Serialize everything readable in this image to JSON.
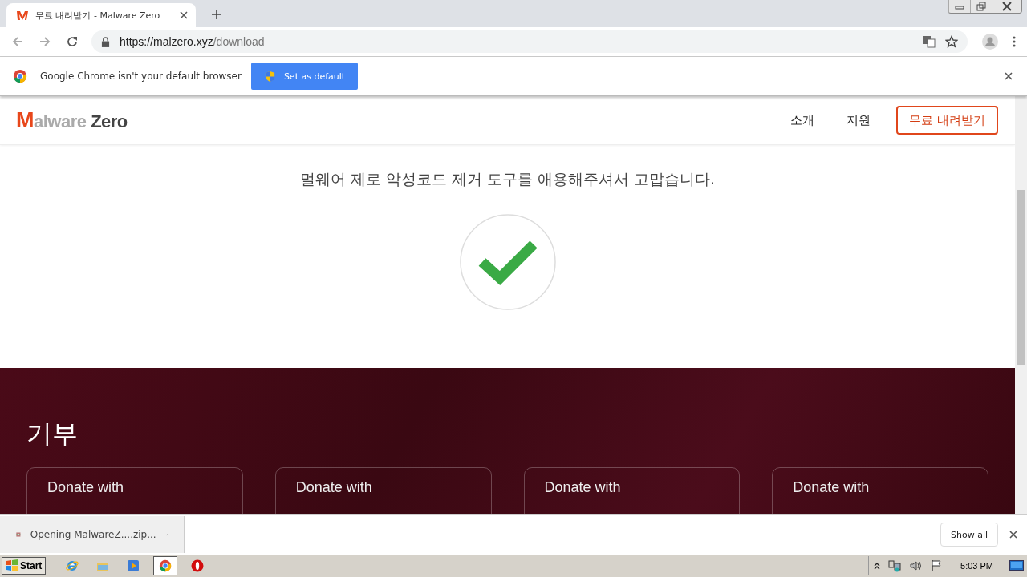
{
  "browser": {
    "tabs": [
      {
        "title": "무료 내려받기 - Malware Zero",
        "selected": true
      }
    ],
    "address": {
      "host": "https://malzero.xyz",
      "path": "/download"
    }
  },
  "infobar": {
    "message": "Google Chrome isn't your default browser",
    "button": "Set as default"
  },
  "site": {
    "logo": {
      "mark": "M",
      "light": "alware",
      "bold": "Zero"
    },
    "nav": [
      {
        "label": "소개"
      },
      {
        "label": "지원"
      }
    ],
    "cta": "무료 내려받기",
    "thanks": "멀웨어 제로 악성코드 제거 도구를 애용해주셔서 고맙습니다.",
    "donate": {
      "heading": "기부",
      "cards": [
        "Donate with",
        "Donate with",
        "Donate with",
        "Donate with"
      ]
    }
  },
  "downloads": {
    "items": [
      {
        "name": "Opening MalwareZ....zip..."
      }
    ],
    "show_all": "Show all"
  },
  "taskbar": {
    "start": "Start",
    "apps": [
      {
        "kind": "ie",
        "selected": false
      },
      {
        "kind": "folder",
        "selected": false
      },
      {
        "kind": "media",
        "selected": false
      },
      {
        "kind": "chrome",
        "selected": true
      },
      {
        "kind": "opera",
        "selected": false
      }
    ],
    "clock": "5:03 PM"
  }
}
